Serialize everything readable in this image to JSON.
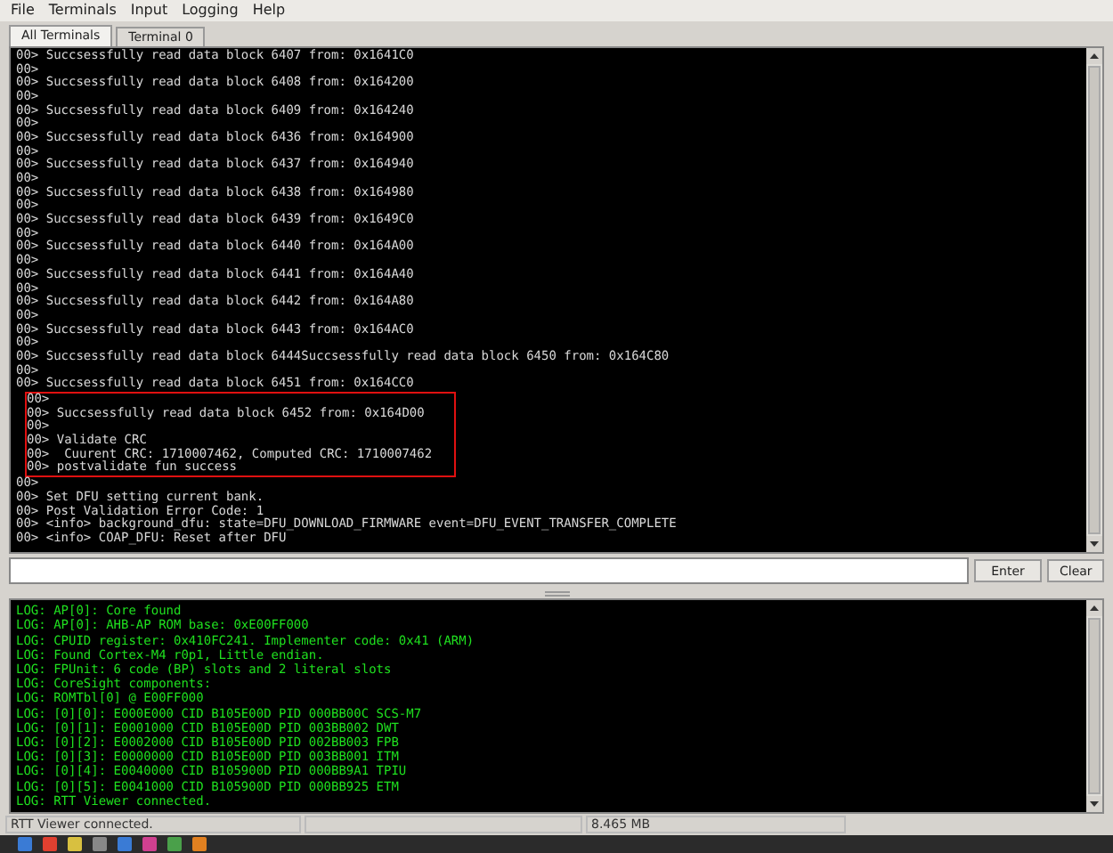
{
  "menu": [
    {
      "label": "File"
    },
    {
      "label": "Terminals"
    },
    {
      "label": "Input"
    },
    {
      "label": "Logging"
    },
    {
      "label": "Help"
    }
  ],
  "tabs": [
    {
      "label": "All Terminals",
      "selected": true
    },
    {
      "label": "Terminal 0",
      "selected": false
    }
  ],
  "terminal": {
    "lines": [
      {
        "text": "00> Succsessfully read data block 6407 from: 0x1641C0",
        "highlighted": false
      },
      {
        "text": "00>",
        "highlighted": false
      },
      {
        "text": "00> Succsessfully read data block 6408 from: 0x164200",
        "highlighted": false
      },
      {
        "text": "00>",
        "highlighted": false
      },
      {
        "text": "00> Succsessfully read data block 6409 from: 0x164240",
        "highlighted": false
      },
      {
        "text": "00>",
        "highlighted": false
      },
      {
        "text": "00> Succsessfully read data block 6436 from: 0x164900",
        "highlighted": false
      },
      {
        "text": "00>",
        "highlighted": false
      },
      {
        "text": "00> Succsessfully read data block 6437 from: 0x164940",
        "highlighted": false
      },
      {
        "text": "00>",
        "highlighted": false
      },
      {
        "text": "00> Succsessfully read data block 6438 from: 0x164980",
        "highlighted": false
      },
      {
        "text": "00>",
        "highlighted": false
      },
      {
        "text": "00> Succsessfully read data block 6439 from: 0x1649C0",
        "highlighted": false
      },
      {
        "text": "00>",
        "highlighted": false
      },
      {
        "text": "00> Succsessfully read data block 6440 from: 0x164A00",
        "highlighted": false
      },
      {
        "text": "00>",
        "highlighted": false
      },
      {
        "text": "00> Succsessfully read data block 6441 from: 0x164A40",
        "highlighted": false
      },
      {
        "text": "00>",
        "highlighted": false
      },
      {
        "text": "00> Succsessfully read data block 6442 from: 0x164A80",
        "highlighted": false
      },
      {
        "text": "00>",
        "highlighted": false
      },
      {
        "text": "00> Succsessfully read data block 6443 from: 0x164AC0",
        "highlighted": false
      },
      {
        "text": "00>",
        "highlighted": false
      },
      {
        "text": "00> Succsessfully read data block 6444Succsessfully read data block 6450 from: 0x164C80",
        "highlighted": false
      },
      {
        "text": "00>",
        "highlighted": false
      },
      {
        "text": "00> Succsessfully read data block 6451 from: 0x164CC0",
        "highlighted": false
      },
      {
        "text": "00>",
        "highlighted": true
      },
      {
        "text": "00> Succsessfully read data block 6452 from: 0x164D00",
        "highlighted": true
      },
      {
        "text": "00>",
        "highlighted": true
      },
      {
        "text": "00> Validate CRC",
        "highlighted": true
      },
      {
        "text": "00>  Cuurent CRC: 1710007462, Computed CRC: 1710007462",
        "highlighted": true
      },
      {
        "text": "00> postvalidate fun success",
        "highlighted": true
      },
      {
        "text": "00>",
        "highlighted": false
      },
      {
        "text": "00> Set DFU setting current bank.",
        "highlighted": false
      },
      {
        "text": "00> Post Validation Error Code: 1",
        "highlighted": false
      },
      {
        "text": "00> <info> background_dfu: state=DFU_DOWNLOAD_FIRMWARE event=DFU_EVENT_TRANSFER_COMPLETE",
        "highlighted": false
      },
      {
        "text": "00> <info> COAP_DFU: Reset after DFU",
        "highlighted": false
      }
    ]
  },
  "input": {
    "buttons": [
      "Enter",
      "Clear"
    ]
  },
  "log": {
    "lines": [
      "LOG: AP[0]: Core found",
      "LOG: AP[0]: AHB-AP ROM base: 0xE00FF000",
      "LOG: CPUID register: 0x410FC241. Implementer code: 0x41 (ARM)",
      "LOG: Found Cortex-M4 r0p1, Little endian.",
      "LOG: FPUnit: 6 code (BP) slots and 2 literal slots",
      "LOG: CoreSight components:",
      "LOG: ROMTbl[0] @ E00FF000",
      "LOG: [0][0]: E000E000 CID B105E00D PID 000BB00C SCS-M7",
      "LOG: [0][1]: E0001000 CID B105E00D PID 003BB002 DWT",
      "LOG: [0][2]: E0002000 CID B105E00D PID 002BB003 FPB",
      "LOG: [0][3]: E0000000 CID B105E00D PID 003BB001 ITM",
      "LOG: [0][4]: E0040000 CID B105900D PID 000BB9A1 TPIU",
      "LOG: [0][5]: E0041000 CID B105900D PID 000BB925 ETM",
      "LOG: RTT Viewer connected."
    ]
  },
  "status_bar": {
    "message": "RTT Viewer connected.",
    "memory": "8.465 MB"
  }
}
